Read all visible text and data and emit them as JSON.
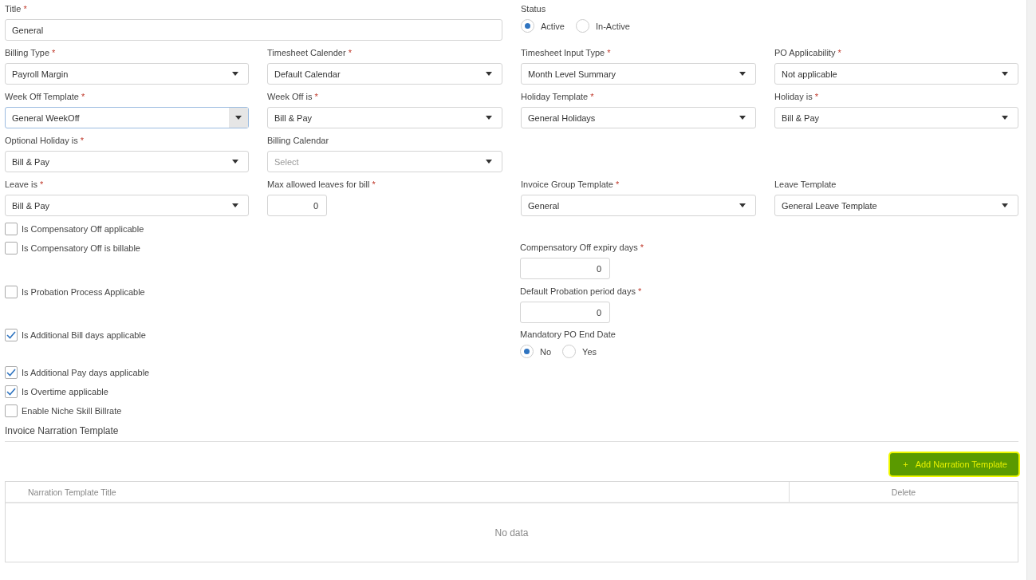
{
  "title_field": {
    "label": "Title",
    "marker": "*",
    "value": "General"
  },
  "status": {
    "label": "Status",
    "options": [
      {
        "label": "Active",
        "selected": true
      },
      {
        "label": "In-Active",
        "selected": false
      }
    ]
  },
  "field_rows": [
    [
      {
        "kind": "select",
        "label": "Billing Type",
        "marker": "*",
        "value": "Payroll Margin",
        "focused": false
      },
      {
        "kind": "select",
        "label": "Timesheet Calender",
        "marker": "*",
        "value": "Default Calendar",
        "focused": false
      },
      {
        "kind": "select",
        "label": "Timesheet Input Type",
        "marker": "*",
        "value": "Month Level Summary",
        "focused": false
      },
      {
        "kind": "select",
        "label": "PO Applicability",
        "marker": "*",
        "value": "Not applicable",
        "focused": false
      }
    ],
    [
      {
        "kind": "select",
        "label": "Week Off Template",
        "marker": "*",
        "value": "General WeekOff",
        "focused": true
      },
      {
        "kind": "select",
        "label": "Week Off is",
        "marker": "*",
        "value": "Bill & Pay",
        "focused": false
      },
      {
        "kind": "select",
        "label": "Holiday Template",
        "marker": "*",
        "value": "General Holidays",
        "focused": false
      },
      {
        "kind": "select",
        "label": "Holiday is",
        "marker": "*",
        "value": "Bill & Pay",
        "focused": false
      }
    ],
    [
      {
        "kind": "select",
        "label": "Optional Holiday is",
        "marker": "*",
        "value": "Bill & Pay",
        "focused": false
      },
      {
        "kind": "select",
        "label": "Billing Calendar",
        "placeholder": "Select",
        "focused": false
      },
      null,
      null
    ],
    [
      {
        "kind": "select",
        "label": "Leave is",
        "marker": "*",
        "value": "Bill & Pay",
        "focused": false
      },
      {
        "kind": "number",
        "label": "Max allowed leaves for bill",
        "marker": "*",
        "value": "0"
      },
      {
        "kind": "select",
        "label": "Invoice Group Template",
        "marker": "*",
        "value": "General",
        "focused": false
      },
      {
        "kind": "select",
        "label": "Leave Template",
        "value": "General Leave Template",
        "focused": false
      }
    ]
  ],
  "option_rows": [
    {
      "checkbox": {
        "label": "Is Compensatory Off applicable",
        "checked": false
      }
    },
    {
      "checkbox": {
        "label": "Is Compensatory Off is billable",
        "checked": false
      },
      "side": {
        "kind": "number",
        "label": "Compensatory Off expiry days",
        "marker": "*",
        "value": "0"
      }
    },
    {
      "checkbox": {
        "label": "Is Probation Process Applicable",
        "checked": false
      },
      "side": {
        "kind": "number",
        "label": "Default Probation period days",
        "marker": "*",
        "value": "0"
      }
    },
    {
      "checkbox": {
        "label": "Is Additional Bill days applicable",
        "checked": true
      },
      "side": {
        "kind": "radio",
        "label": "Mandatory PO End Date",
        "options": [
          {
            "label": "No",
            "selected": true
          },
          {
            "label": "Yes",
            "selected": false
          }
        ]
      }
    },
    {
      "checkbox": {
        "label": "Is Additional Pay days applicable",
        "checked": true
      }
    },
    {
      "checkbox": {
        "label": "Is Overtime applicable",
        "checked": true
      }
    },
    {
      "checkbox": {
        "label": "Enable Niche Skill Billrate",
        "checked": false
      }
    }
  ],
  "narration": {
    "heading": "Invoice Narration Template",
    "add_button": {
      "icon": "+",
      "label": "Add Narration Template"
    },
    "table": {
      "columns": [
        "Narration Template Title",
        "Delete"
      ],
      "empty_text": "No data"
    }
  }
}
